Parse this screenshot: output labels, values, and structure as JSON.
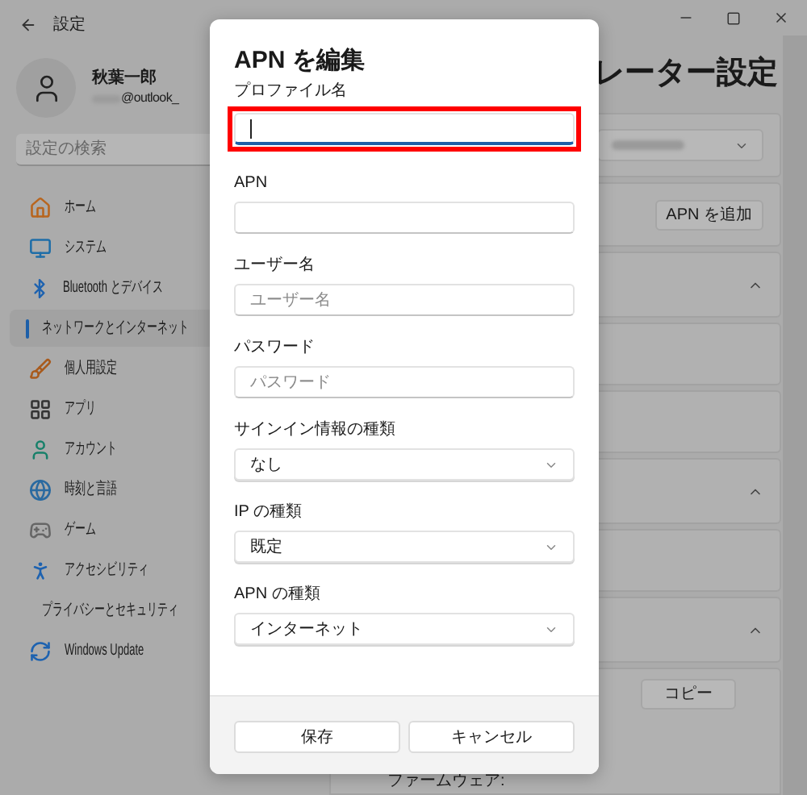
{
  "window": {
    "title": "設定"
  },
  "account": {
    "name": "秋葉一郎",
    "email": "@outlook_"
  },
  "search": {
    "placeholder": "設定の検索"
  },
  "nav": [
    {
      "kind": "home",
      "label": "ホーム",
      "selected": false
    },
    {
      "kind": "system",
      "label": "システム",
      "selected": false
    },
    {
      "kind": "bluetooth",
      "label": "Bluetooth とデバイス",
      "selected": false
    },
    {
      "kind": "network",
      "label": "ネットワークとインターネット",
      "selected": true
    },
    {
      "kind": "personalize",
      "label": "個人用設定",
      "selected": false
    },
    {
      "kind": "apps",
      "label": "アプリ",
      "selected": false
    },
    {
      "kind": "account",
      "label": "アカウント",
      "selected": false
    },
    {
      "kind": "time",
      "label": "時刻と言語",
      "selected": false
    },
    {
      "kind": "game",
      "label": "ゲーム",
      "selected": false
    },
    {
      "kind": "accessibility",
      "label": "アクセシビリティ",
      "selected": false
    },
    {
      "kind": "privacy",
      "label": "プライバシーとセキュリティ",
      "selected": false
    },
    {
      "kind": "update",
      "label": "Windows Update",
      "selected": false
    }
  ],
  "page": {
    "title": "レーター設定",
    "add_apn_button": "APN を追加",
    "copy_button": "コピー",
    "firmware_label": "ファームウェア:",
    "cards": [
      {
        "kind": "dropdown"
      },
      {
        "kind": "add"
      },
      {
        "kind": "expander",
        "expanded": true
      },
      {
        "kind": "row"
      },
      {
        "kind": "row"
      },
      {
        "kind": "expander",
        "expanded": true
      },
      {
        "kind": "row"
      },
      {
        "kind": "expander",
        "expanded": true
      },
      {
        "kind": "copy"
      }
    ]
  },
  "dialog": {
    "title": "APN を編集",
    "fields": [
      {
        "kind": "text",
        "label": "プロファイル名",
        "focused": true,
        "highlighted": true
      },
      {
        "kind": "text",
        "label": "APN",
        "focused": false,
        "highlighted": false
      },
      {
        "kind": "text",
        "label": "ユーザー名",
        "placeholder": "ユーザー名",
        "focused": false,
        "highlighted": false
      },
      {
        "kind": "text",
        "label": "パスワード",
        "placeholder": "パスワード",
        "focused": false,
        "highlighted": false
      },
      {
        "kind": "select",
        "label": "サインイン情報の種類",
        "value": "なし",
        "highlighted": false
      },
      {
        "kind": "select",
        "label": "IP の種類",
        "value": "既定",
        "highlighted": false
      },
      {
        "kind": "select",
        "label": "APN の種類",
        "value": "インターネット",
        "highlighted": false
      }
    ],
    "buttons": [
      "保存",
      "キャンセル"
    ]
  }
}
